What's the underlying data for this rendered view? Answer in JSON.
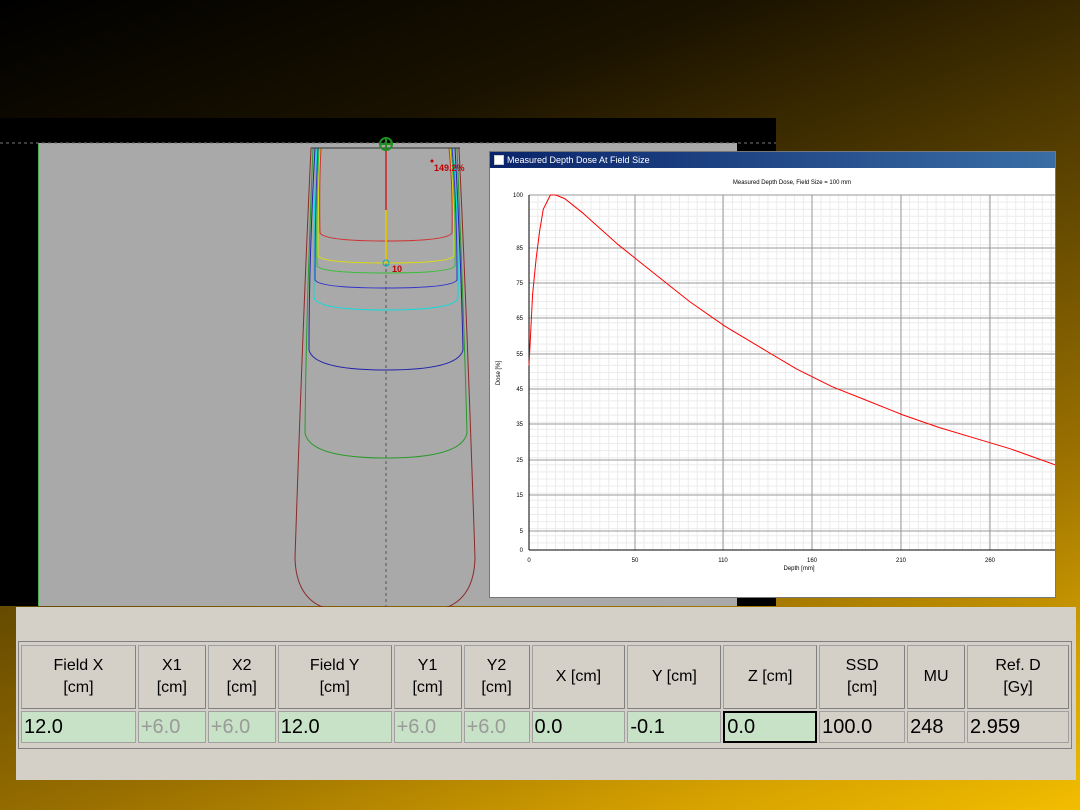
{
  "dose_view": {
    "max_dose_label": "149.2%",
    "marker_label": "10"
  },
  "graph_window": {
    "title": "Measured Depth Dose At Field Size"
  },
  "chart_data": {
    "type": "line",
    "title": "Measured Depth Dose, Field Size = 100 mm",
    "xlabel": "Depth [mm]",
    "ylabel": "Dose [%]",
    "x_ticks": [
      "0",
      "50",
      "110",
      "160",
      "210",
      "260"
    ],
    "y_ticks": [
      "100",
      "85",
      "75",
      "65",
      "55",
      "45",
      "35",
      "25",
      "15",
      "5",
      "0"
    ],
    "grid": true,
    "series": [
      {
        "color": "#ff0000",
        "x": [
          0,
          2,
          4,
          6,
          8,
          12,
          15,
          20,
          30,
          50,
          70,
          90,
          110,
          130,
          150,
          170,
          190,
          210,
          230,
          250,
          270,
          295
        ],
        "y": [
          52,
          72,
          82,
          90,
          96,
          100,
          100,
          99,
          95,
          86,
          78,
          70,
          63,
          57,
          51,
          46,
          42,
          38,
          34.5,
          31.5,
          28.5,
          24
        ]
      }
    ]
  },
  "table": {
    "headers": [
      [
        "Field X",
        "[cm]"
      ],
      [
        "X1",
        "[cm]"
      ],
      [
        "X2",
        "[cm]"
      ],
      [
        "Field Y",
        "[cm]"
      ],
      [
        "Y1",
        "[cm]"
      ],
      [
        "Y2",
        "[cm]"
      ],
      [
        "X [cm]",
        ""
      ],
      [
        "Y [cm]",
        ""
      ],
      [
        "Z [cm]",
        ""
      ],
      [
        "SSD",
        "[cm]"
      ],
      [
        "MU",
        ""
      ],
      [
        "Ref. D",
        "[Gy]"
      ]
    ],
    "row": [
      "12.0",
      "+6.0",
      "+6.0",
      "12.0",
      "+6.0",
      "+6.0",
      "0.0",
      "-0.1",
      "0.0",
      "100.0",
      "248",
      "2.959"
    ]
  }
}
